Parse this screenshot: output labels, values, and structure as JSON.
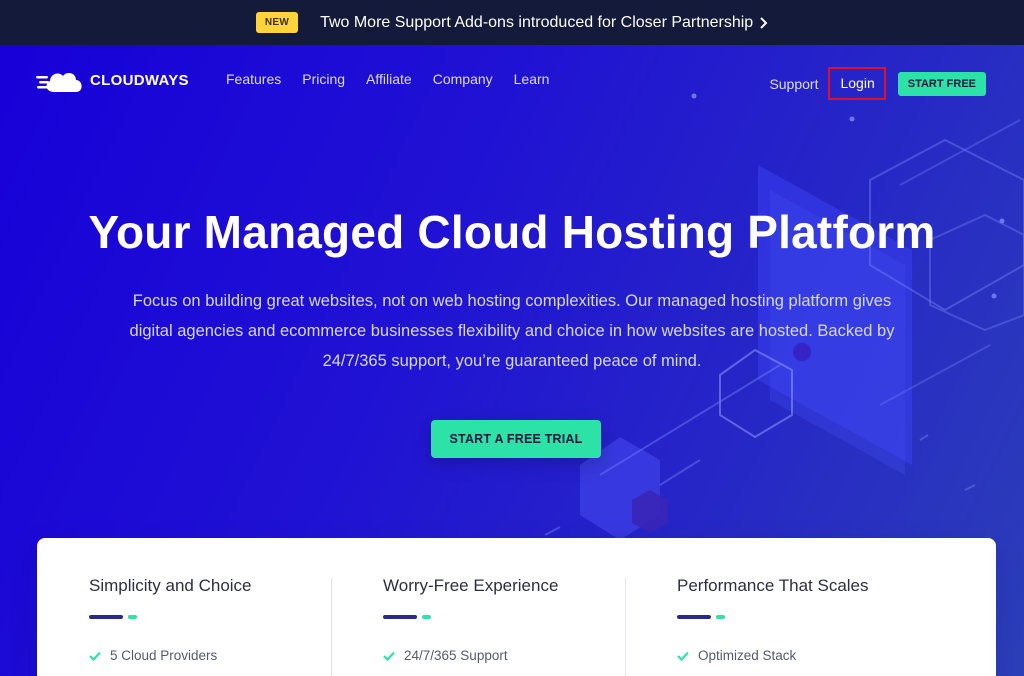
{
  "announcement": {
    "badge": "NEW",
    "text": "Two More Support Add-ons introduced for Closer Partnership",
    "arrow_icon": "chevron-right-icon"
  },
  "nav": {
    "logo_text": "CLOUDWAYS",
    "logo_icon": "cloud-icon",
    "links": [
      "Features",
      "Pricing",
      "Affiliate",
      "Company",
      "Learn"
    ],
    "support": "Support",
    "login": "Login",
    "start_free": "START FREE"
  },
  "hero": {
    "title": "Your Managed Cloud Hosting Platform",
    "description": "Focus on building great websites, not on web hosting complexities. Our managed hosting platform gives digital agencies and ecommerce businesses flexibility and choice in how websites are hosted. Backed by 24/7/365 support, you’re guaranteed peace of mind.",
    "cta": "START A FREE TRIAL"
  },
  "features": [
    {
      "title": "Simplicity and Choice",
      "item": "5 Cloud Providers"
    },
    {
      "title": "Worry-Free Experience",
      "item": "24/7/365 Support"
    },
    {
      "title": "Performance That Scales",
      "item": "Optimized Stack"
    }
  ],
  "colors": {
    "announcement_bg": "#131a3a",
    "hero_bg": "#1a0fd6",
    "accent_green": "#2de2a6",
    "badge_yellow": "#ffd43b",
    "login_highlight": "#e0102a"
  }
}
